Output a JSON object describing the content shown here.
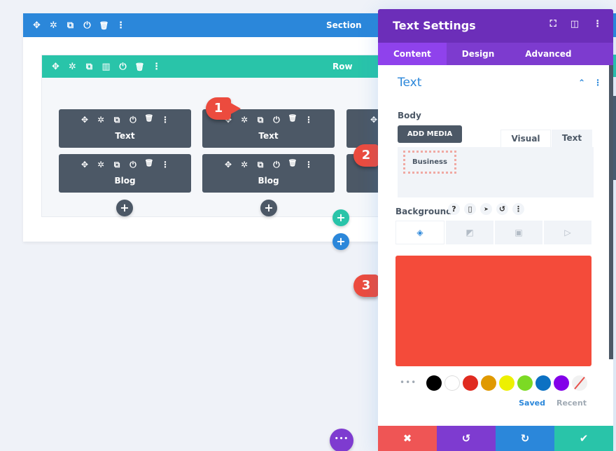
{
  "section": {
    "title": "Section",
    "color": "#2b87da",
    "icons": [
      "move-icon",
      "gear-icon",
      "duplicate-icon",
      "power-icon",
      "trash-icon",
      "more-icon"
    ]
  },
  "row": {
    "title": "Row",
    "color": "#29c4a9",
    "icons": [
      "move-icon",
      "gear-icon",
      "duplicate-icon",
      "columns-icon",
      "power-icon",
      "trash-icon",
      "more-icon"
    ]
  },
  "modules": [
    {
      "label": "Text"
    },
    {
      "label": "Text"
    },
    {
      "label": "Blog"
    },
    {
      "label": "Blog"
    }
  ],
  "callouts": [
    "1",
    "2",
    "3"
  ],
  "settings_modal": {
    "title": "Text Settings",
    "header_icons": [
      "focus-icon",
      "sidebar-icon",
      "more-icon"
    ],
    "tabs": [
      {
        "label": "Content",
        "active": true
      },
      {
        "label": "Design",
        "active": false
      },
      {
        "label": "Advanced",
        "active": false
      }
    ],
    "toggle_title": "Text",
    "body_label": "Body",
    "add_media_label": "ADD MEDIA",
    "editor_tabs": {
      "visual": "Visual",
      "text": "Text"
    },
    "editor_content": "Business",
    "background_label": "Background",
    "background_tab_icons": [
      "paint-bucket-icon",
      "gradient-icon",
      "image-icon",
      "video-icon"
    ],
    "background_color": "#f44b3a",
    "swatches": [
      "#000000",
      "#ffffff",
      "#e02b20",
      "#e09900",
      "#edf000",
      "#7cda24",
      "#0c71c3",
      "#8300e9"
    ],
    "saved_label": "Saved",
    "recent_label": "Recent",
    "footer_buttons": [
      {
        "name": "cancel",
        "color": "#ef5555"
      },
      {
        "name": "undo",
        "color": "#7e3bd0"
      },
      {
        "name": "redo",
        "color": "#2b87da"
      },
      {
        "name": "save",
        "color": "#29c4a9"
      }
    ]
  },
  "glyphs": {
    "move": "✥",
    "gear": "✲",
    "duplicate": "⧉",
    "columns": "▥",
    "power": "⏻",
    "trash": "🗑",
    "more": "⋮",
    "plus": "+",
    "focus": "⛶",
    "sidebar": "◫",
    "chevron_up": "⌃",
    "help": "?",
    "phone": "▯",
    "pointer": "➤",
    "reset": "↺",
    "paint": "◈",
    "gradient": "◩",
    "image": "▣",
    "video": "▷",
    "close": "✖",
    "undo": "↺",
    "redo": "↻",
    "check": "✔",
    "ellipsis": "•••"
  }
}
